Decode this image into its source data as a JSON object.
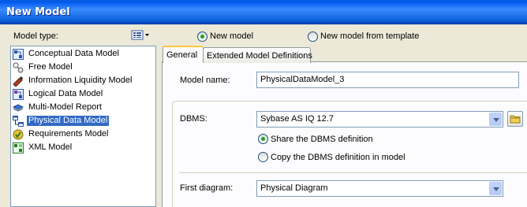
{
  "window": {
    "title": "New Model"
  },
  "model_type": {
    "label": "Model type:",
    "items": [
      {
        "label": "Conceptual Data Model",
        "icon": "conceptual-model-icon"
      },
      {
        "label": "Free Model",
        "icon": "free-model-icon"
      },
      {
        "label": "Information Liquidity Model",
        "icon": "information-liquidity-icon"
      },
      {
        "label": "Logical Data Model",
        "icon": "logical-model-icon"
      },
      {
        "label": "Multi-Model Report",
        "icon": "multi-model-report-icon"
      },
      {
        "label": "Physical Data Model",
        "icon": "physical-model-icon",
        "selected": true
      },
      {
        "label": "Requirements Model",
        "icon": "requirements-model-icon"
      },
      {
        "label": "XML Model",
        "icon": "xml-model-icon"
      }
    ]
  },
  "creation_mode": {
    "options": [
      {
        "label": "New model",
        "checked": true
      },
      {
        "label": "New model from template",
        "checked": false
      }
    ]
  },
  "tabs": [
    {
      "label": "General",
      "active": true
    },
    {
      "label": "Extended Model Definitions",
      "active": false
    }
  ],
  "general": {
    "model_name_label": "Model name:",
    "model_name_value": "PhysicalDataModel_3",
    "dbms_label": "DBMS:",
    "dbms_value": "Sybase AS IQ 12.7",
    "dbms_options": [
      {
        "label": "Share the DBMS definition",
        "checked": true
      },
      {
        "label": "Copy the DBMS definition in model",
        "checked": false
      }
    ],
    "first_diagram_label": "First diagram:",
    "first_diagram_value": "Physical Diagram"
  }
}
